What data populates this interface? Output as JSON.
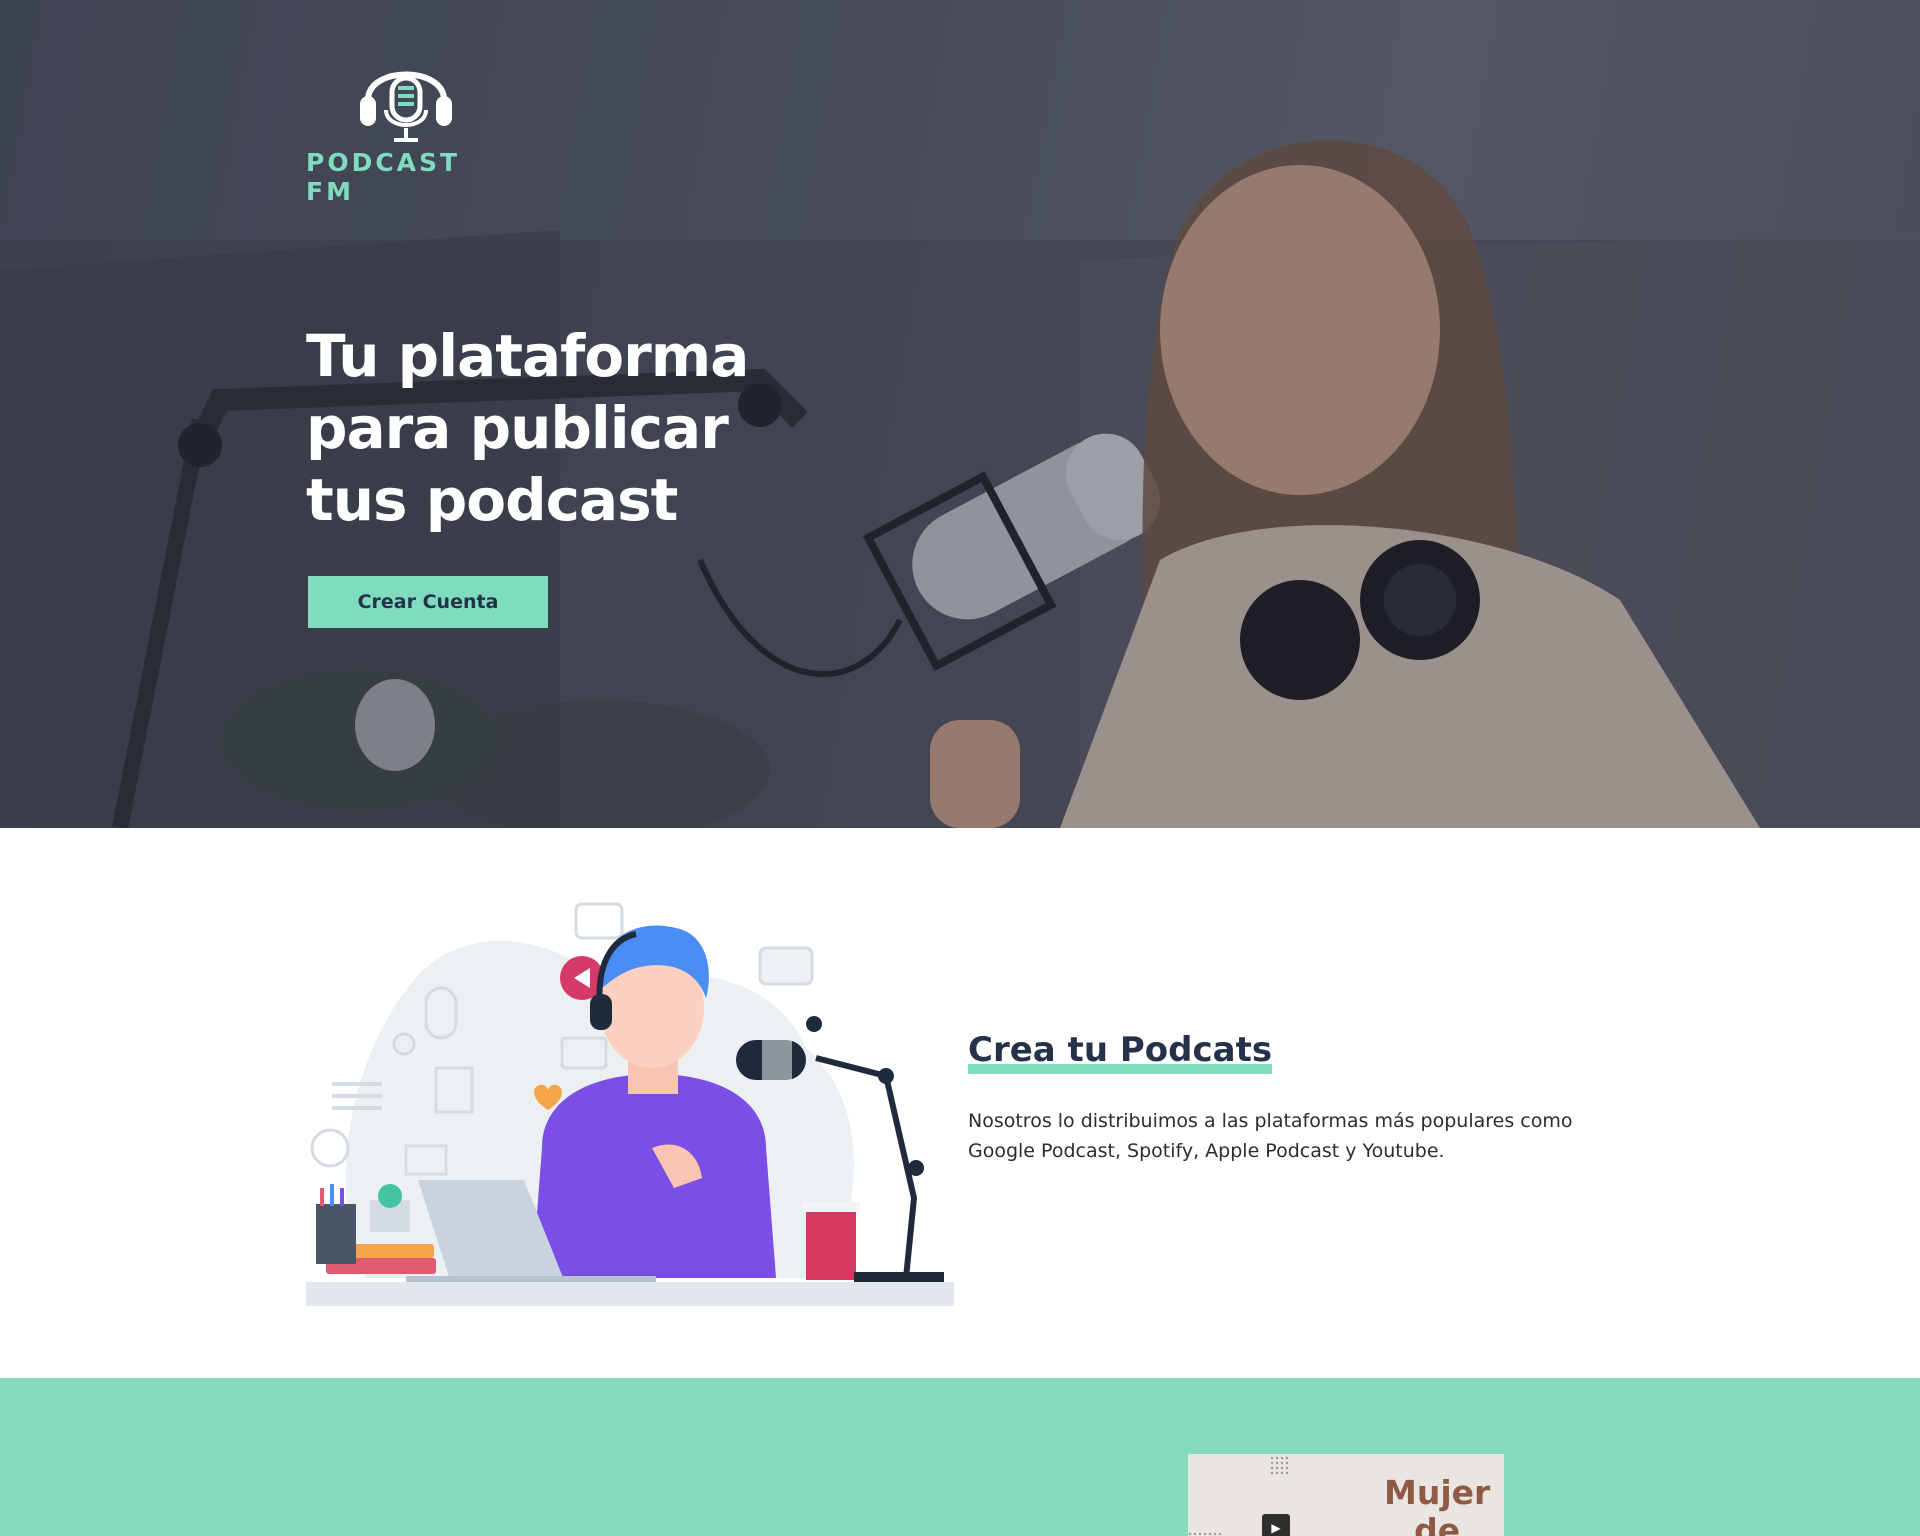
{
  "brand": {
    "name": "PODCAST FM",
    "accent_color": "#80dcbe",
    "dark_text_color": "#26324a"
  },
  "hero": {
    "title_lines": [
      "Tu plataforma",
      "para publicar",
      "tus podcast"
    ],
    "cta_label": "Crear Cuenta",
    "image": "woman-recording-podcast-photo"
  },
  "feature": {
    "heading": "Crea tu Podcats",
    "body": "Nosotros lo distribuimos a las plataformas más populares como Google Podcast, Spotify, Apple Podcast y Youtube.",
    "illustration": "man-with-headphones-podcasting-illustration"
  },
  "podcast_card": {
    "title_lines": [
      "Mujer",
      "de"
    ],
    "icon": "play-icon"
  }
}
